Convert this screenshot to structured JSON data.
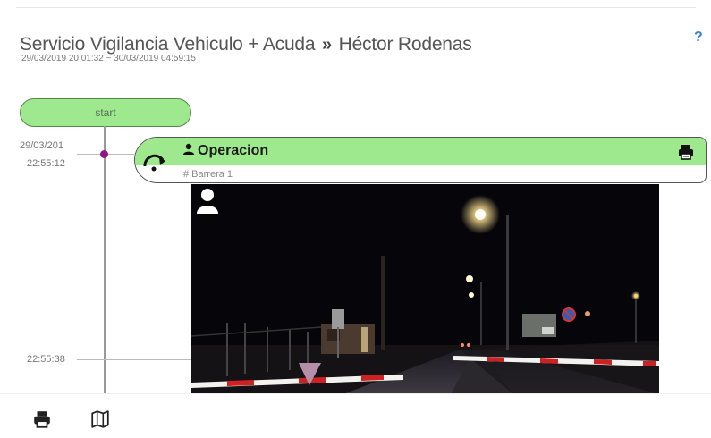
{
  "header": {
    "title": "Servicio Vigilancia Vehiculo + Acuda",
    "separator": "»",
    "person": "Héctor Rodenas",
    "date_range": "29/03/2019 20:01:32 ~ 30/03/2019 04:59:15",
    "help_label": "?"
  },
  "timeline": {
    "start_label": "start",
    "time1_date": "29/03/201",
    "time1_time": "22:55:12",
    "time2": "22:55:38",
    "dot_color": "#8a1a8a"
  },
  "event": {
    "title": "Operacion",
    "subtitle": "# Barrera 1",
    "icon": "redo-arrow-icon",
    "print_icon": "print-icon",
    "header_color": "#9ee88e"
  },
  "photo": {
    "icon": "user-icon"
  },
  "bottom_toolbar": {
    "print_icon": "print-icon",
    "map_icon": "map-icon"
  }
}
